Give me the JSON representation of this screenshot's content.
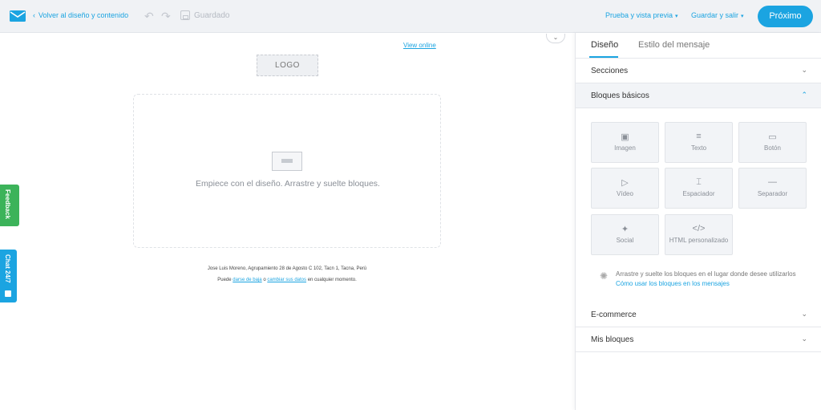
{
  "header": {
    "back_label": "Volver al diseño y contenido",
    "saved_label": "Guardado",
    "preview_menu": "Prueba y vista previa",
    "save_exit_menu": "Guardar y salir",
    "next_button": "Próximo"
  },
  "canvas": {
    "view_online": "View online",
    "logo_placeholder": "LOGO",
    "drop_hint": "Empiece con el diseño. Arrastre y suelte bloques.",
    "footer_address": "Jose Luis Moreno, Agrupamiento 28 de Agosto C 102, Tacn 1, Tacna, Perú",
    "footer_prefix": "Puede",
    "footer_unsub_link": "darse de baja",
    "footer_or": "o",
    "footer_change_link": "cambiar sus datos",
    "footer_suffix": "en cualquier momento."
  },
  "side_tabs": {
    "feedback": "Feedback",
    "chat": "Chat 24/7"
  },
  "panel": {
    "tabs": [
      "Diseño",
      "Estilo del mensaje"
    ],
    "sections": {
      "secciones": "Secciones",
      "basicos": "Bloques básicos",
      "ecommerce": "E-commerce",
      "mis_bloques": "Mis bloques"
    },
    "blocks": [
      {
        "label": "Imagen",
        "icon": "image-icon"
      },
      {
        "label": "Texto",
        "icon": "text-icon"
      },
      {
        "label": "Botón",
        "icon": "button-icon"
      },
      {
        "label": "Vídeo",
        "icon": "video-icon"
      },
      {
        "label": "Espaciador",
        "icon": "spacer-icon"
      },
      {
        "label": "Separador",
        "icon": "separator-icon"
      },
      {
        "label": "Social",
        "icon": "social-icon"
      },
      {
        "label": "HTML personalizado",
        "icon": "code-icon"
      }
    ],
    "hint_text": "Arrastre y suelte los bloques en el lugar donde desee utilizarlos",
    "hint_link": "Cómo usar los bloques en los mensajes"
  },
  "colors": {
    "accent": "#1ba4e1",
    "feedback": "#3cb35a"
  }
}
